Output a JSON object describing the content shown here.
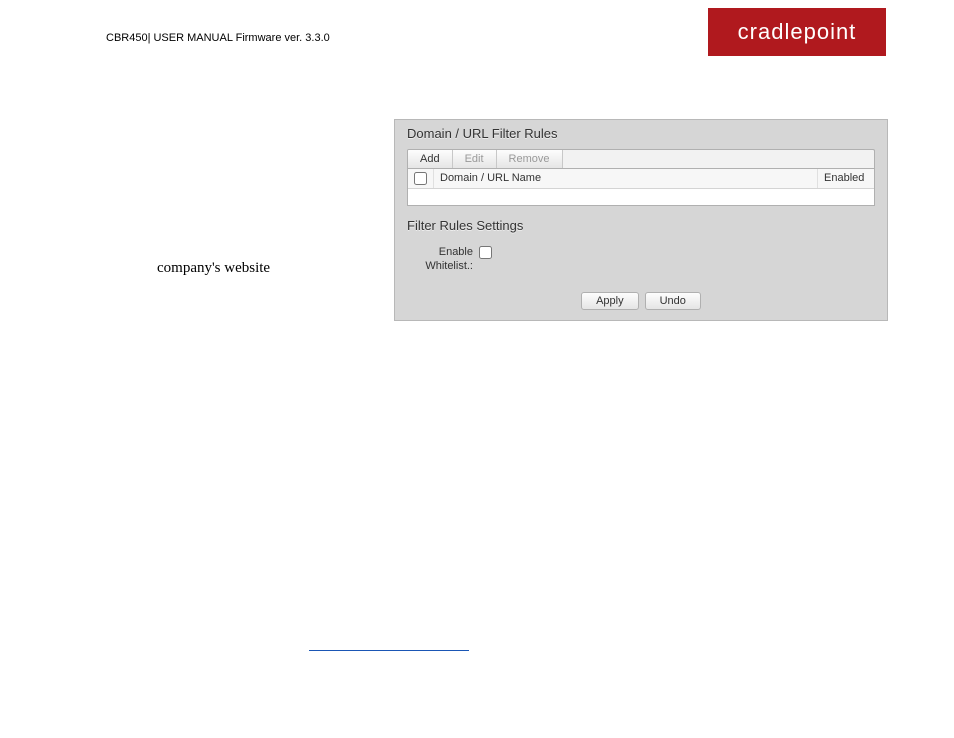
{
  "header": {
    "text": "CBR450| USER MANUAL Firmware ver. 3.3.0"
  },
  "logo": {
    "text": "cradlepoint"
  },
  "body": {
    "text": "company's website"
  },
  "panel": {
    "section1_title": "Domain / URL Filter Rules",
    "toolbar": {
      "add": "Add",
      "edit": "Edit",
      "remove": "Remove"
    },
    "table": {
      "col_name": "Domain / URL Name",
      "col_enabled": "Enabled"
    },
    "section2_title": "Filter Rules Settings",
    "settings": {
      "enable_label": "Enable Whitelist.:"
    },
    "buttons": {
      "apply": "Apply",
      "undo": "Undo"
    }
  }
}
